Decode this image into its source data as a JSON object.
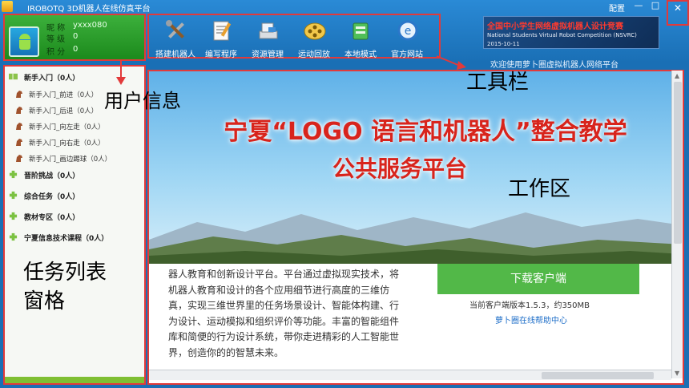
{
  "app": {
    "title": "IROBOTQ 3D机器人在线仿真平台",
    "settings_label": "配置",
    "minimize_glyph": "—",
    "maximize_glyph": "□",
    "close_glyph": "✕"
  },
  "user": {
    "nickname_label": "昵 称",
    "nickname_value": "yxxx080",
    "level_label": "等 级",
    "level_value": "0",
    "points_label": "积 分",
    "points_value": "0"
  },
  "toolbar": {
    "items": [
      {
        "label": "搭建机器人",
        "icon": "tools-icon"
      },
      {
        "label": "编写程序",
        "icon": "program-icon"
      },
      {
        "label": "资源管理",
        "icon": "resources-icon"
      },
      {
        "label": "运动回放",
        "icon": "film-reel-icon"
      },
      {
        "label": "本地模式",
        "icon": "local-mode-icon"
      },
      {
        "label": "官方网站",
        "icon": "browser-icon"
      }
    ]
  },
  "banner": {
    "title": "全国中小学生网络虚拟机器人设计竞赛",
    "subtitle": "National Students Virtual Robot Competition (NSVRC)",
    "date": "2015-10-11"
  },
  "welcome_text": "欢迎使用萝卜圈虚拟机器人网络平台",
  "tasks": {
    "groups": [
      {
        "label": "新手入门（0人）"
      },
      {
        "label": "晋阶挑战（0人）"
      },
      {
        "label": "综合任务（0人）"
      },
      {
        "label": "教材专区（0人）"
      },
      {
        "label": "宁夏信息技术课程（0人）"
      }
    ],
    "items": [
      {
        "label": "新手入门_前进（0人）"
      },
      {
        "label": "新手入门_后退（0人）"
      },
      {
        "label": "新手入门_向左走（0人）"
      },
      {
        "label": "新手入门_向右走（0人）"
      },
      {
        "label": "新手入门_画边踢球（0人）"
      }
    ]
  },
  "workspace": {
    "headline1": "宁夏“LOGO 语言和机器人”整合教学",
    "headline2": "公共服务平台",
    "description": "器人教育和创新设计平台。平台通过虚拟现实技术，将机器人教育和设计的各个应用细节进行高度的三维仿真，实现三维世界里的任务场景设计、智能体构建、行为设计、运动模拟和组织评价等功能。丰富的智能组件库和简便的行为设计系统，带你走进精彩的人工智能世界，创造你的的智慧未来。",
    "download_label": "下载客户端",
    "version_text": "当前客户端版本1.5.3，约350MB",
    "help_link": "萝卜圈在线帮助中心"
  },
  "annotations": {
    "user_info": "用户信息",
    "toolbar": "工具栏",
    "workspace": "工作区",
    "task_pane": "任务列表窗格"
  },
  "colors": {
    "annotation_border": "#e23a3a",
    "title_blue": "#1a6fb5",
    "user_green": "#2a9a2a",
    "download_green": "#52b848",
    "headline_red": "#d8241c"
  }
}
